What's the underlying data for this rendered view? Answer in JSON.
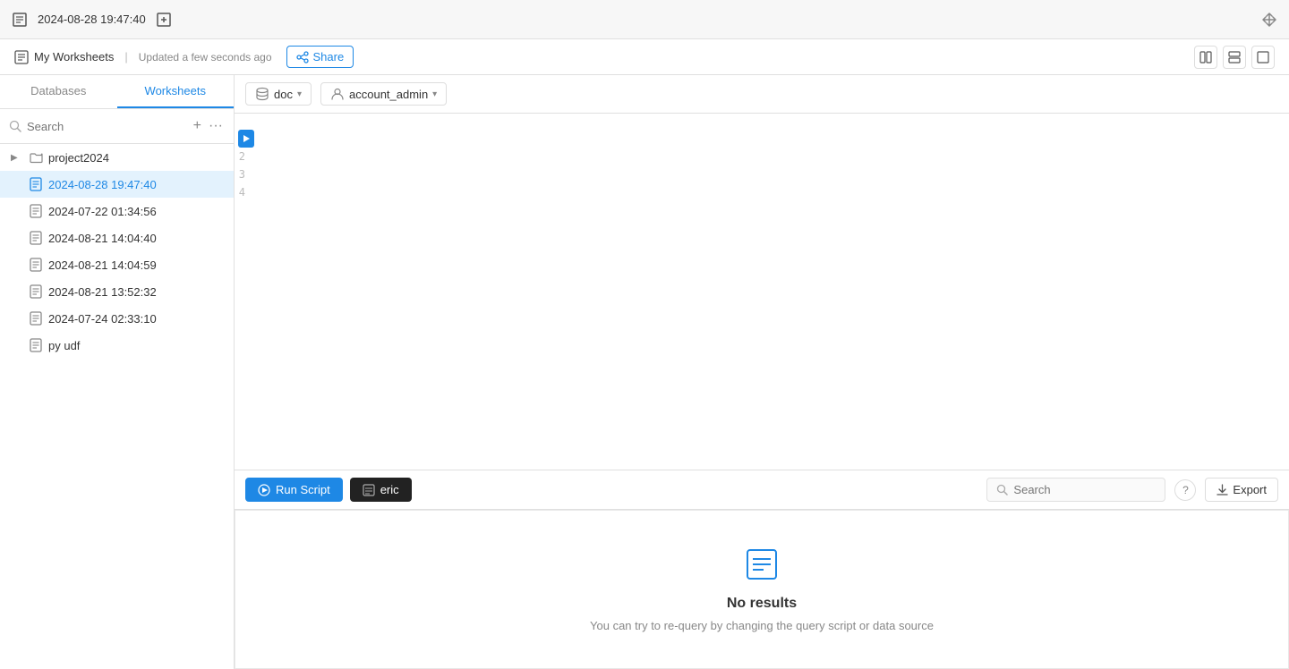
{
  "topbar": {
    "title": "2024-08-28 19:47:40",
    "new_tab_icon": "new-tab-icon",
    "move_icon": "move-icon"
  },
  "secondbar": {
    "my_worksheets": "My Worksheets",
    "separator": "|",
    "updated_text": "Updated a few seconds ago",
    "share_label": "Share"
  },
  "sidebar": {
    "tabs": [
      {
        "label": "Databases",
        "active": false
      },
      {
        "label": "Worksheets",
        "active": true
      }
    ],
    "search_placeholder": "Search",
    "items": [
      {
        "label": "project2024",
        "type": "folder",
        "active": false,
        "has_chevron": true
      },
      {
        "label": "2024-08-28 19:47:40",
        "type": "doc",
        "active": true,
        "has_chevron": false
      },
      {
        "label": "2024-07-22 01:34:56",
        "type": "doc",
        "active": false,
        "has_chevron": false
      },
      {
        "label": "2024-08-21 14:04:40",
        "type": "doc",
        "active": false,
        "has_chevron": false
      },
      {
        "label": "2024-08-21 14:04:59",
        "type": "doc",
        "active": false,
        "has_chevron": false
      },
      {
        "label": "2024-08-21 13:52:32",
        "type": "doc",
        "active": false,
        "has_chevron": false
      },
      {
        "label": "2024-07-24 02:33:10",
        "type": "doc",
        "active": false,
        "has_chevron": false
      },
      {
        "label": "py udf",
        "type": "doc",
        "active": false,
        "has_chevron": false
      }
    ]
  },
  "editor": {
    "db_selector": "doc",
    "role_selector": "account_admin",
    "line_numbers": [
      "1",
      "2",
      "3",
      "4"
    ]
  },
  "bottom": {
    "run_script_label": "Run Script",
    "active_tab_label": "eric",
    "search_placeholder": "Search",
    "help_icon": "help-icon",
    "export_label": "Export"
  },
  "results": {
    "no_results_title": "No results",
    "no_results_desc": "You can try to re-query by changing the query script or data source"
  },
  "colors": {
    "blue": "#1e88e5",
    "dark": "#222222"
  }
}
